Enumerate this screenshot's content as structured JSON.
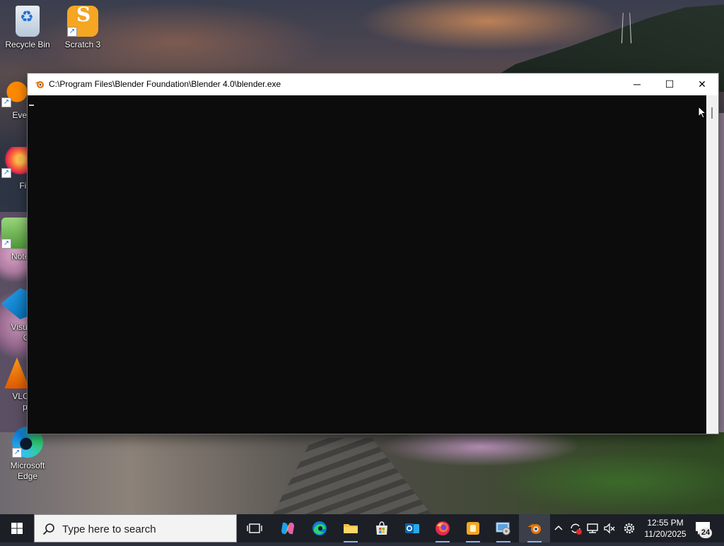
{
  "desktop": {
    "icons": [
      {
        "label": "Recycle Bin",
        "icon": "recycle-bin-icon"
      },
      {
        "label": "Scratch 3",
        "icon": "scratch-icon"
      },
      {
        "label": "Every",
        "icon": "everything-search-icon"
      },
      {
        "label": "Fire",
        "icon": "firefox-icon"
      },
      {
        "label": "Notep",
        "icon": "notepad-plus-plus-icon"
      },
      {
        "label": "Visual",
        "label2": "Co",
        "icon": "vscode-icon"
      },
      {
        "label": "VLC r",
        "label2": "pla",
        "icon": "vlc-icon"
      },
      {
        "label": "Microsoft",
        "label2": "Edge",
        "icon": "edge-icon"
      }
    ]
  },
  "window": {
    "title": "C:\\Program Files\\Blender Foundation\\Blender 4.0\\blender.exe",
    "icon": "blender-icon",
    "minimize_glyph": "─",
    "maximize_glyph": "☐",
    "close_glyph": "✕",
    "console_text": ""
  },
  "taskbar": {
    "search_placeholder": "Type here to search",
    "pinned": [
      {
        "name": "task-view",
        "icon": "task-view-icon"
      },
      {
        "name": "copilot",
        "icon": "copilot-icon"
      },
      {
        "name": "edge",
        "icon": "edge-icon"
      },
      {
        "name": "file-explorer",
        "icon": "folder-icon"
      },
      {
        "name": "microsoft-store",
        "icon": "store-icon"
      },
      {
        "name": "outlook",
        "icon": "outlook-icon"
      },
      {
        "name": "firefox",
        "icon": "firefox-icon"
      },
      {
        "name": "scratch",
        "icon": "scratch-icon"
      },
      {
        "name": "control-panel",
        "icon": "control-panel-icon"
      },
      {
        "name": "blender",
        "icon": "blender-icon"
      }
    ],
    "tray": {
      "time": "12:55 PM",
      "date": "11/20/2025",
      "notification_count": "24"
    }
  },
  "colors": {
    "console_bg": "#0c0c0c",
    "taskbar_bg": "#1c1f26",
    "titlebar_bg": "#ffffff",
    "blender_orange": "#ea7600"
  }
}
